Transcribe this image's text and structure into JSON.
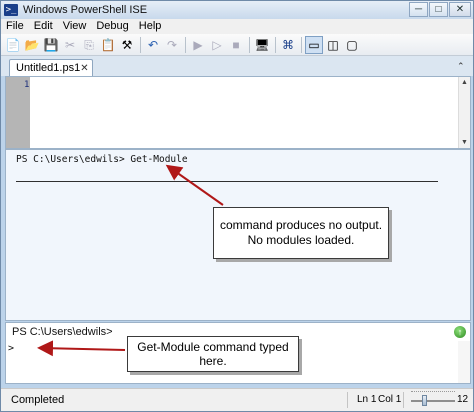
{
  "window": {
    "title": "Windows PowerShell ISE",
    "app_icon": ">_",
    "controls": {
      "minimize": "─",
      "maximize": "□",
      "close": "✕"
    }
  },
  "menu": [
    "File",
    "Edit",
    "View",
    "Debug",
    "Help"
  ],
  "toolbar": {
    "icons": [
      {
        "name": "new-icon",
        "glyph": "📄"
      },
      {
        "name": "open-icon",
        "glyph": "📂"
      },
      {
        "name": "save-icon",
        "glyph": "💾"
      },
      {
        "name": "cut-icon",
        "glyph": "✂"
      },
      {
        "name": "copy-icon",
        "glyph": "⎘"
      },
      {
        "name": "paste-icon",
        "glyph": "📋"
      },
      {
        "name": "clear-icon",
        "glyph": "⚒"
      },
      {
        "name": "undo-icon",
        "glyph": "↶"
      },
      {
        "name": "redo-icon",
        "glyph": "↷"
      },
      {
        "name": "run-icon",
        "glyph": "▶"
      },
      {
        "name": "run-selection-icon",
        "glyph": "▷"
      },
      {
        "name": "stop-icon",
        "glyph": "■"
      },
      {
        "name": "remote-icon",
        "glyph": "🖥"
      },
      {
        "name": "powershell-icon",
        "glyph": "⌘"
      },
      {
        "name": "layout-top-icon",
        "glyph": "▭"
      },
      {
        "name": "layout-right-icon",
        "glyph": "◫"
      },
      {
        "name": "layout-max-icon",
        "glyph": "▢"
      }
    ]
  },
  "tab": {
    "label": "Untitled1.ps1",
    "close": "✕"
  },
  "script": {
    "line_number": "1"
  },
  "output": {
    "line": "PS C:\\Users\\edwils> Get-Module"
  },
  "callouts": {
    "output_note_1": "command produces no output.",
    "output_note_2": "No modules loaded.",
    "command_note_1": "Get-Module command typed",
    "command_note_2": "here."
  },
  "command": {
    "prompt": "PS C:\\Users\\edwils>",
    "caret": ">"
  },
  "status": {
    "text": "Completed",
    "ln": "Ln 1",
    "col": "Col 1",
    "zoom": "12"
  }
}
